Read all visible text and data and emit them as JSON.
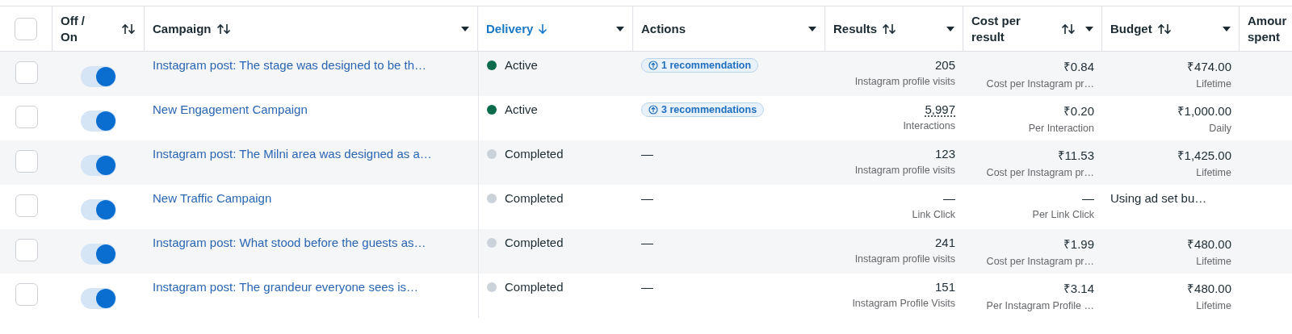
{
  "table": {
    "select_all": {
      "checked": false
    },
    "columns": [
      {
        "label": "Off / On",
        "sort_icon": true,
        "menu": false,
        "selected": false
      },
      {
        "label": "Campaign",
        "sort_icon": true,
        "menu": true,
        "selected": false
      },
      {
        "label": "Delivery",
        "sort_icon": true,
        "menu": true,
        "selected": true
      },
      {
        "label": "Actions",
        "sort_icon": false,
        "menu": true,
        "selected": false
      },
      {
        "label": "Results",
        "sort_icon": true,
        "menu": true,
        "selected": false
      },
      {
        "label": "Cost per result",
        "sort_icon": true,
        "menu": true,
        "selected": false
      },
      {
        "label": "Budget",
        "sort_icon": true,
        "menu": true,
        "selected": false
      },
      {
        "label": "Amour spent",
        "selected": false
      }
    ],
    "rows": [
      {
        "checked": false,
        "on": true,
        "campaign": "Instagram post: The stage was designed to be th…",
        "delivery": {
          "status": "Active",
          "color": "#0b6b4b"
        },
        "actions": {
          "kind": "recommendation",
          "text": "1 recommendation"
        },
        "results": {
          "value": "205",
          "label": "Instagram profile visits",
          "dotted": false
        },
        "cost": {
          "value": "₹0.84",
          "label": "Cost per Instagram pr…"
        },
        "budget": {
          "kind": "amount",
          "value": "₹474.00",
          "label": "Lifetime"
        }
      },
      {
        "checked": false,
        "on": true,
        "campaign": "New Engagement Campaign",
        "delivery": {
          "status": "Active",
          "color": "#0b6b4b"
        },
        "actions": {
          "kind": "recommendation",
          "text": "3 recommendations"
        },
        "results": {
          "value": "5,997",
          "label": "Interactions",
          "dotted": true
        },
        "cost": {
          "value": "₹0.20",
          "label": "Per Interaction"
        },
        "budget": {
          "kind": "amount",
          "value": "₹1,000.00",
          "label": "Daily"
        }
      },
      {
        "checked": false,
        "on": true,
        "campaign": "Instagram post: The Milni area was designed as a…",
        "delivery": {
          "status": "Completed",
          "color": "#cbd2d9"
        },
        "actions": {
          "kind": "none",
          "text": "—"
        },
        "results": {
          "value": "123",
          "label": "Instagram profile visits",
          "dotted": false
        },
        "cost": {
          "value": "₹11.53",
          "label": "Cost per Instagram pr…"
        },
        "budget": {
          "kind": "amount",
          "value": "₹1,425.00",
          "label": "Lifetime"
        }
      },
      {
        "checked": false,
        "on": true,
        "campaign": "New Traffic Campaign",
        "delivery": {
          "status": "Completed",
          "color": "#cbd2d9"
        },
        "actions": {
          "kind": "none",
          "text": "—"
        },
        "results": {
          "value": "—",
          "label": "Link Click",
          "dotted": false
        },
        "cost": {
          "value": "—",
          "label": "Per Link Click"
        },
        "budget": {
          "kind": "note",
          "value": "Using ad set bu…"
        }
      },
      {
        "checked": false,
        "on": true,
        "campaign": "Instagram post: What stood before the guests as…",
        "delivery": {
          "status": "Completed",
          "color": "#cbd2d9"
        },
        "actions": {
          "kind": "none",
          "text": "—"
        },
        "results": {
          "value": "241",
          "label": "Instagram profile visits",
          "dotted": false
        },
        "cost": {
          "value": "₹1.99",
          "label": "Cost per Instagram pr…"
        },
        "budget": {
          "kind": "amount",
          "value": "₹480.00",
          "label": "Lifetime"
        }
      },
      {
        "checked": false,
        "on": true,
        "campaign": "Instagram post: The grandeur everyone sees is…",
        "delivery": {
          "status": "Completed",
          "color": "#cbd2d9"
        },
        "actions": {
          "kind": "none",
          "text": "—"
        },
        "results": {
          "value": "151",
          "label": "Instagram Profile Visits",
          "dotted": false
        },
        "cost": {
          "value": "₹3.14",
          "label": "Per Instagram Profile …"
        },
        "budget": {
          "kind": "amount",
          "value": "₹480.00",
          "label": "Lifetime"
        }
      }
    ]
  }
}
